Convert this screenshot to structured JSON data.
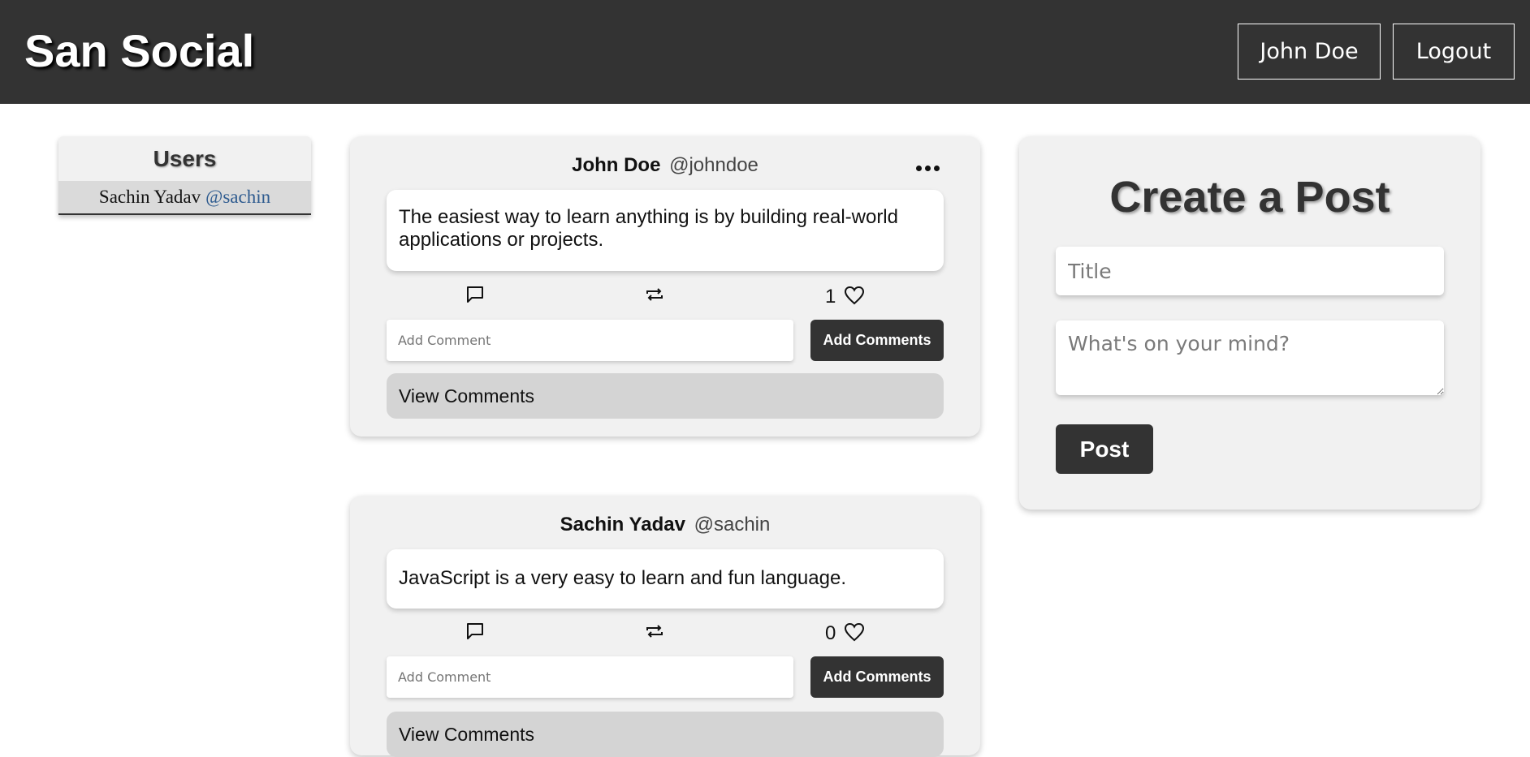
{
  "header": {
    "brand": "San Social",
    "user_button": "John Doe",
    "logout_button": "Logout"
  },
  "users_panel": {
    "title": "Users",
    "users": [
      {
        "name": "Sachin Yadav",
        "handle": "@sachin"
      }
    ]
  },
  "posts": [
    {
      "author": "John Doe",
      "handle": "@johndoe",
      "body": "The easiest way to learn anything is by building real-world applications or projects.",
      "likes": "1",
      "has_menu": true,
      "comment_placeholder": "Add Comment",
      "add_comment_label": "Add Comments",
      "view_comments_label": "View Comments"
    },
    {
      "author": "Sachin Yadav",
      "handle": "@sachin",
      "body": "JavaScript is a very easy to learn and fun language.",
      "likes": "0",
      "has_menu": false,
      "comment_placeholder": "Add Comment",
      "add_comment_label": "Add Comments",
      "view_comments_label": "View Comments"
    }
  ],
  "create_post": {
    "title": "Create a Post",
    "title_placeholder": "Title",
    "body_placeholder": "What's on your mind?",
    "post_button": "Post"
  },
  "icons": {
    "comment": "comment-icon",
    "repost": "repost-icon",
    "like": "heart-icon",
    "more": "more-icon"
  },
  "colors": {
    "header_bg": "#333333",
    "panel_bg": "#f1f1f1",
    "button_bg": "#333333",
    "view_comments_bg": "#d4d4d4",
    "handle_link": "#2e5b8f"
  }
}
